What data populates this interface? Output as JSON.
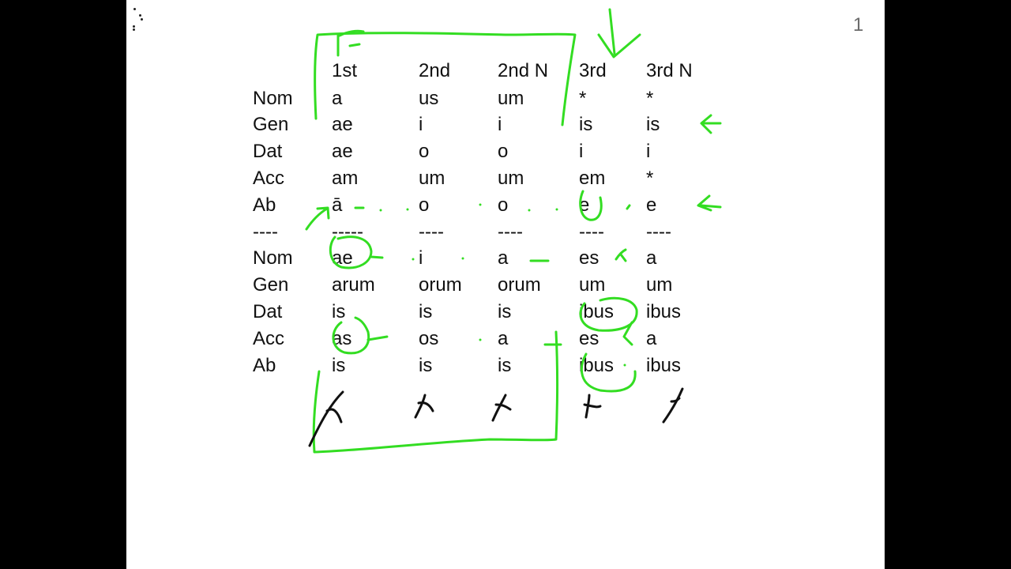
{
  "slide": {
    "page_number": "1",
    "accent_color": "#33dd22"
  },
  "table": {
    "columns": [
      "1st",
      "2nd",
      "2nd N",
      "3rd",
      "3rd N"
    ],
    "singular": [
      {
        "case": "Nom",
        "values": [
          "a",
          "us",
          "um",
          "*",
          "*"
        ]
      },
      {
        "case": "Gen",
        "values": [
          "ae",
          "i",
          "i",
          "is",
          "is"
        ]
      },
      {
        "case": "Dat",
        "values": [
          "ae",
          "o",
          "o",
          "i",
          "i"
        ]
      },
      {
        "case": "Acc",
        "values": [
          "am",
          "um",
          "um",
          "em",
          "*"
        ]
      },
      {
        "case": "Ab",
        "values": [
          "ā",
          "o",
          "o",
          "e",
          "e"
        ]
      }
    ],
    "separator": [
      "----",
      "-----",
      "----",
      "----",
      "----",
      "----"
    ],
    "plural": [
      {
        "case": "Nom",
        "values": [
          "ae",
          "i",
          "a",
          "es",
          "a"
        ]
      },
      {
        "case": "Gen",
        "values": [
          "arum",
          "orum",
          "orum",
          "um",
          "um"
        ]
      },
      {
        "case": "Dat",
        "values": [
          "is",
          "is",
          "is",
          "ibus",
          "ibus"
        ]
      },
      {
        "case": "Acc",
        "values": [
          "as",
          "os",
          "a",
          "es",
          "a"
        ]
      },
      {
        "case": "Ab",
        "values": [
          "is",
          "is",
          "is",
          "ibus",
          "ibus"
        ]
      }
    ]
  }
}
